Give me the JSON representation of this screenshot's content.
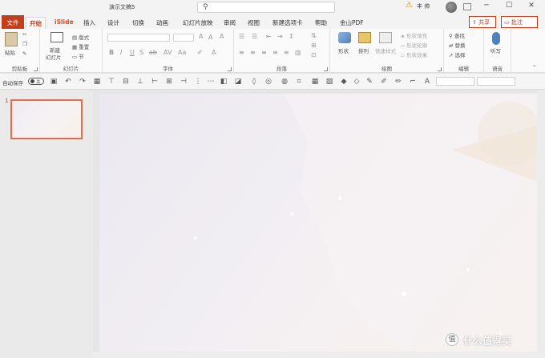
{
  "window": {
    "title": "演示文稿5",
    "search_placeholder": "",
    "user": "丰 帅"
  },
  "tabs": [
    "文件",
    "开始",
    "iSlide",
    "插入",
    "设计",
    "切换",
    "动画",
    "幻灯片放映",
    "审阅",
    "视图",
    "新建选项卡",
    "帮助",
    "金山PDF"
  ],
  "share": "共享",
  "comment": "批注",
  "ribbon": {
    "clipboard": {
      "label": "剪贴板",
      "paste": "粘贴"
    },
    "slides": {
      "label": "幻灯片",
      "new_slide": "新建",
      "new_slide2": "幻灯片",
      "layout": "版式",
      "reset": "重置",
      "section": "节"
    },
    "font": {
      "label": "字体"
    },
    "paragraph": {
      "label": "段落"
    },
    "drawing": {
      "label": "绘图",
      "shape": "形状",
      "arrange": "排列",
      "quick_styles": "快速样式",
      "fill": "形状填充",
      "outline": "形状轮廓",
      "effects": "形状效果"
    },
    "editing": {
      "label": "编辑",
      "find": "查找",
      "replace": "替换",
      "select": "选择"
    },
    "voice": {
      "label": "语音",
      "dictate": "听写"
    }
  },
  "qat": {
    "autosave": "自动保存",
    "toggle": "关"
  },
  "slides_pane": {
    "number": "1"
  },
  "watermark": "什么值得买",
  "watermark_badge": "值",
  "colors": {
    "accent": "#c43e1c",
    "thumb_border": "#e36c4d"
  }
}
